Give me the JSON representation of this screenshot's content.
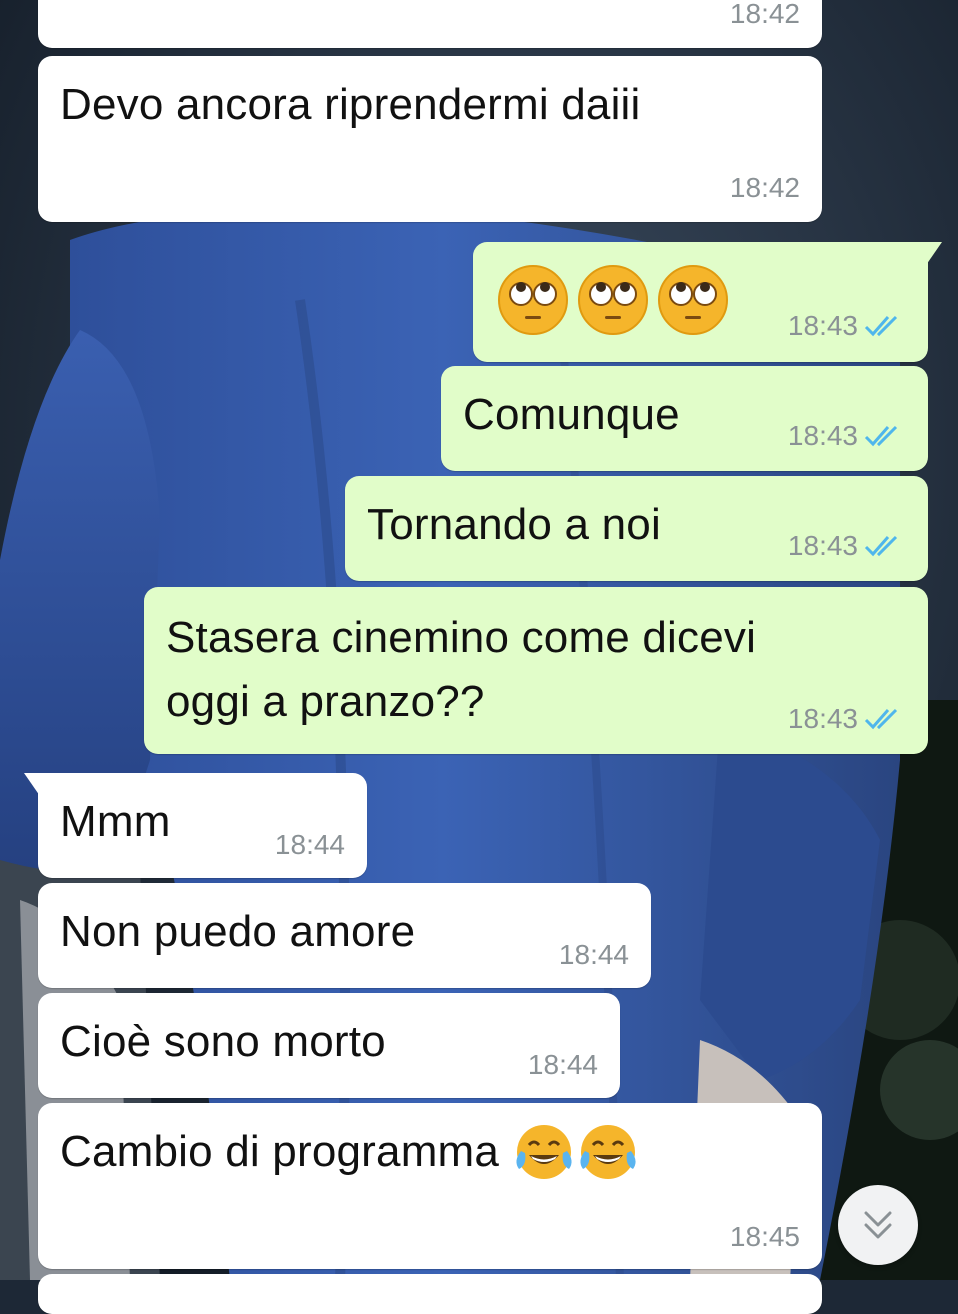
{
  "chat": {
    "messages": [
      {
        "id": "m0",
        "direction": "in",
        "text": "",
        "time": "18:42"
      },
      {
        "id": "m1",
        "direction": "in",
        "text": "Devo ancora riprendermi daiii",
        "time": "18:42"
      },
      {
        "id": "m2",
        "direction": "out",
        "text": "",
        "emoji": [
          "face-with-rolling-eyes",
          "face-with-rolling-eyes",
          "face-with-rolling-eyes"
        ],
        "time": "18:43",
        "status": "read"
      },
      {
        "id": "m3",
        "direction": "out",
        "text": "Comunque",
        "time": "18:43",
        "status": "read"
      },
      {
        "id": "m4",
        "direction": "out",
        "text": "Tornando a noi",
        "time": "18:43",
        "status": "read"
      },
      {
        "id": "m5",
        "direction": "out",
        "text_line1": "Stasera cinemino come dicevi",
        "text_line2": "oggi a pranzo??",
        "time": "18:43",
        "status": "read"
      },
      {
        "id": "m6",
        "direction": "in",
        "text": "Mmm",
        "time": "18:44"
      },
      {
        "id": "m7",
        "direction": "in",
        "text": "Non puedo amore",
        "time": "18:44"
      },
      {
        "id": "m8",
        "direction": "in",
        "text": "Cioè sono morto",
        "time": "18:44"
      },
      {
        "id": "m9",
        "direction": "in",
        "text": "Cambio di programma",
        "emoji": [
          "face-with-tears-of-joy",
          "face-with-tears-of-joy"
        ],
        "time": "18:45"
      }
    ]
  },
  "scroll_button": {
    "icon": "double-chevron-down-icon"
  },
  "colors": {
    "incoming_bubble": "#ffffff",
    "outgoing_bubble": "#e1fdc9",
    "read_ticks": "#4fb6ec",
    "timestamp": "#8a9195"
  }
}
